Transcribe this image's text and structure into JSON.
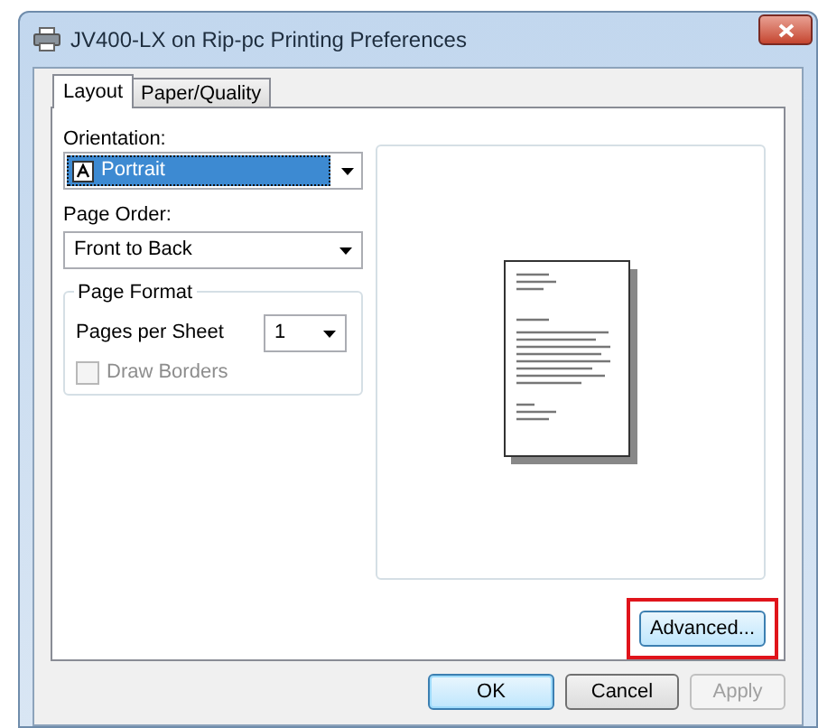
{
  "window": {
    "title": "JV400-LX on Rip-pc Printing Preferences"
  },
  "tabs": [
    {
      "label": "Layout",
      "selected": true
    },
    {
      "label": "Paper/Quality",
      "selected": false
    }
  ],
  "orientation": {
    "label": "Orientation:",
    "value": "Portrait",
    "focused": true
  },
  "page_order": {
    "label": "Page Order:",
    "value": "Front to Back"
  },
  "page_format": {
    "title": "Page Format",
    "pages_per_sheet": {
      "label": "Pages per Sheet",
      "value": "1"
    },
    "draw_borders": {
      "label": "Draw Borders",
      "checked": false,
      "disabled": true
    }
  },
  "advanced_button": {
    "label": "Advanced...",
    "highlighted": true
  },
  "buttons": [
    {
      "label": "OK",
      "default": true,
      "disabled": false
    },
    {
      "label": "Cancel",
      "default": false,
      "disabled": false
    },
    {
      "label": "Apply",
      "default": false,
      "disabled": true
    }
  ]
}
